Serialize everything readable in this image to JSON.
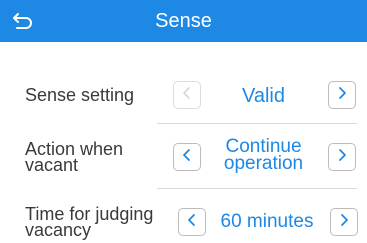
{
  "header": {
    "title": "Sense",
    "back_icon": "back-arrow-icon",
    "background": "#1e88e5"
  },
  "settings": [
    {
      "label_lines": [
        "Sense setting"
      ],
      "value_lines": [
        "Valid"
      ],
      "prev_enabled": false,
      "next_enabled": true
    },
    {
      "label_lines": [
        "Action when",
        "vacant"
      ],
      "value_lines": [
        "Continue",
        "operation"
      ],
      "prev_enabled": true,
      "next_enabled": true
    },
    {
      "label_lines": [
        "Time for judging",
        "vacancy"
      ],
      "value_lines": [
        "60 minutes"
      ],
      "prev_enabled": true,
      "next_enabled": true
    }
  ],
  "icons": {
    "prev": "chevron-left-icon",
    "next": "chevron-right-icon"
  },
  "colors": {
    "accent": "#1e88e5",
    "label": "#3a3a3a",
    "border": "#bcbcbc"
  }
}
